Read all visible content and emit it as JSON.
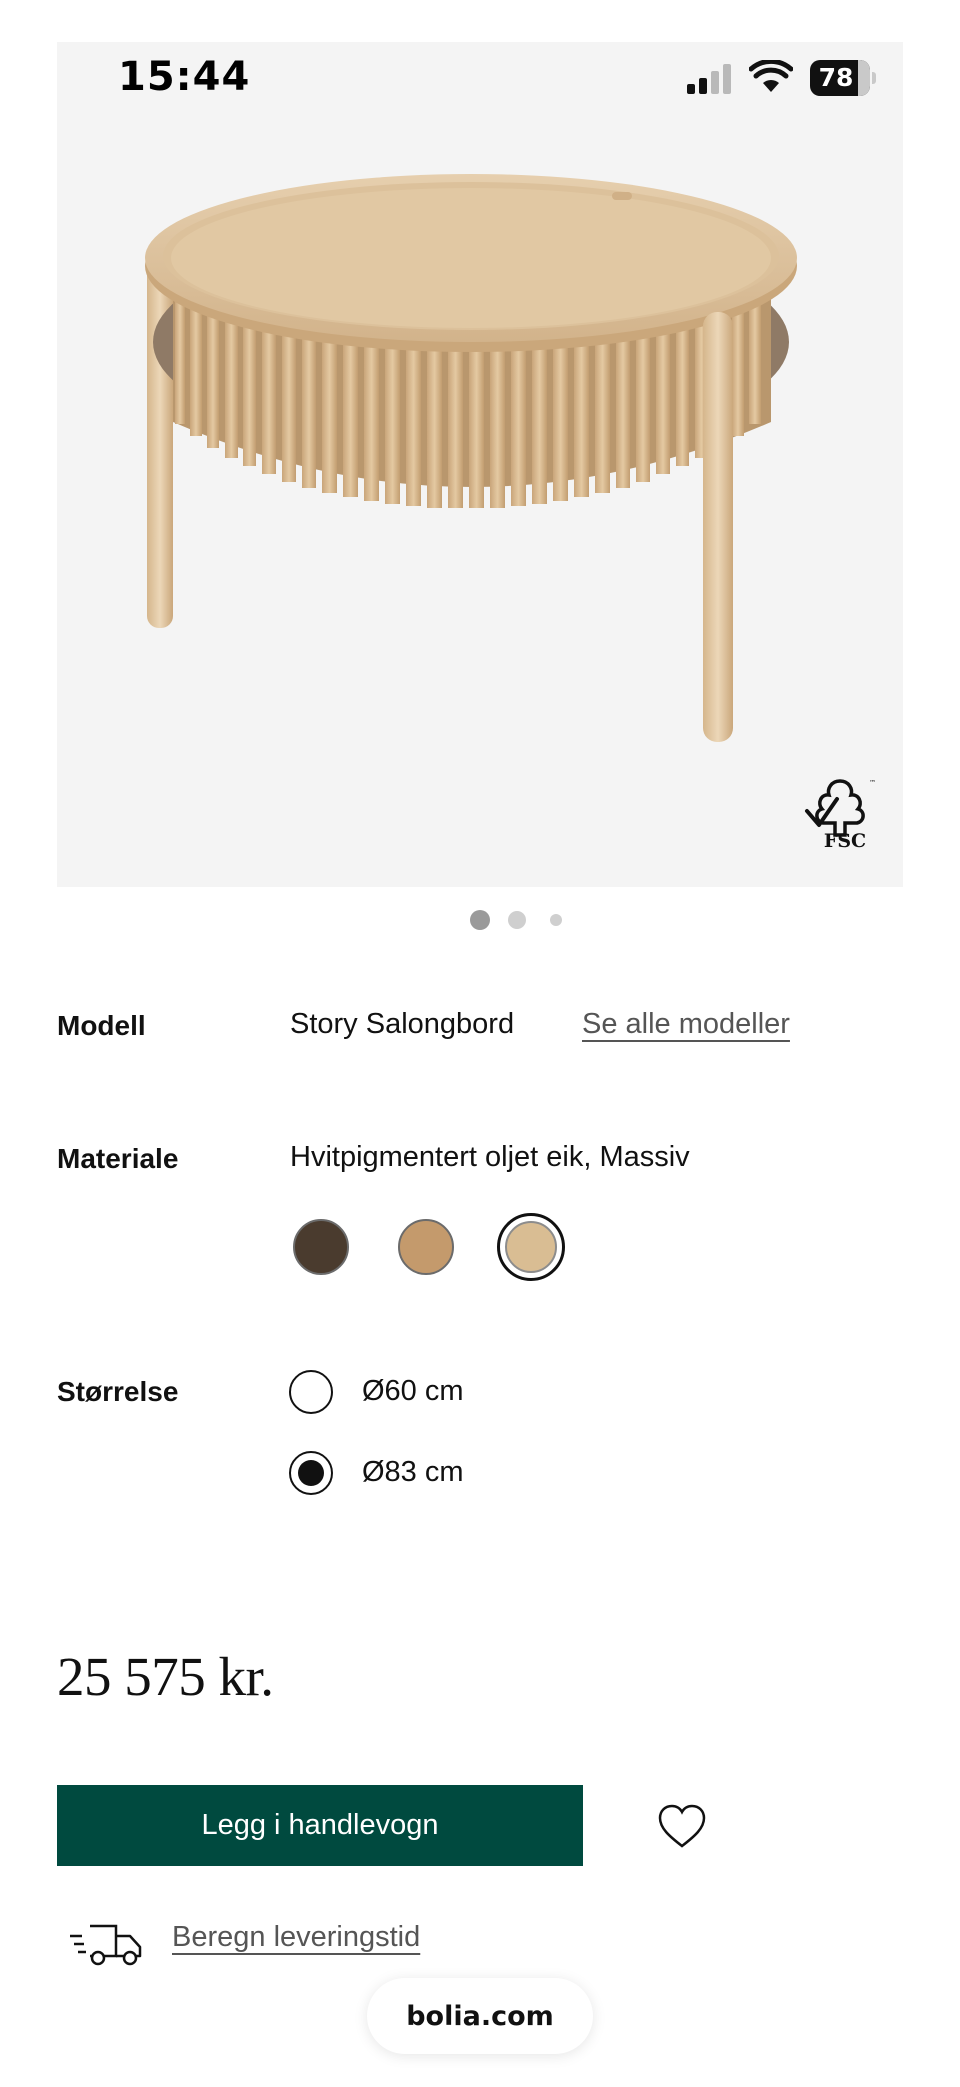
{
  "status_bar": {
    "time": "15:44",
    "battery": "78",
    "icons": [
      "signal-icon",
      "wifi-icon",
      "battery-icon"
    ]
  },
  "product_image": {
    "carousel_index": 1,
    "carousel_count": 3,
    "certification_logo": "FSC"
  },
  "model": {
    "label": "Modell",
    "value": "Story Salongbord",
    "link": "Se alle modeller"
  },
  "material": {
    "label": "Materiale",
    "value": "Hvitpigmentert oljet eik, Massiv",
    "swatch_colors": [
      "#4a3b2e",
      "#c49a6c",
      "#d9bd93"
    ],
    "selected_index": 2
  },
  "size": {
    "label": "Størrelse",
    "options": [
      "Ø60 cm",
      "Ø83 cm"
    ],
    "selected_index": 1
  },
  "price": "25 575 kr.",
  "actions": {
    "add_to_cart": "Legg i handlevogn",
    "delivery_link": "Beregn leveringstid",
    "accent_color": "#004a3f"
  },
  "browser": {
    "url": "bolia.com"
  }
}
